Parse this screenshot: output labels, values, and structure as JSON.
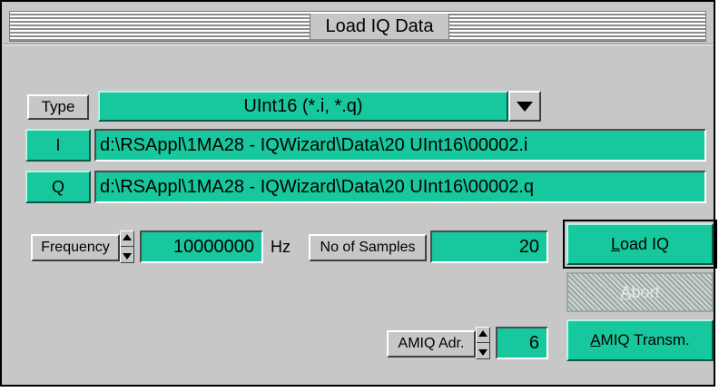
{
  "window": {
    "title": "Load IQ Data"
  },
  "type_row": {
    "label": "Type",
    "value": "UInt16 (*.i, *.q)",
    "dropdown_icon": "chevron-down-icon"
  },
  "i_row": {
    "button_label": "I",
    "path": "d:\\RSAppl\\1MA28 - IQWizard\\Data\\20 UInt16\\00002.i"
  },
  "q_row": {
    "button_label": "Q",
    "path": "d:\\RSAppl\\1MA28 - IQWizard\\Data\\20 UInt16\\00002.q"
  },
  "frequency": {
    "label": "Frequency",
    "value": "10000000",
    "unit": "Hz"
  },
  "samples": {
    "label": "No of Samples",
    "value": "20"
  },
  "buttons": {
    "load_iq_first": "L",
    "load_iq_rest": "oad IQ",
    "abort_first": "A",
    "abort_rest": "bort",
    "amiq_transm_first": "A",
    "amiq_transm_rest": "MIQ Transm."
  },
  "amiq": {
    "label": "AMIQ Adr.",
    "value": "6"
  },
  "colors": {
    "accent_green": "#17c89e",
    "panel_gray": "#c7c7c7"
  }
}
